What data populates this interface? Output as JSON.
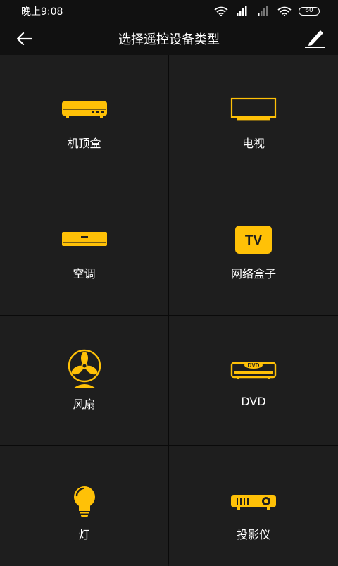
{
  "status": {
    "time": "晚上9:08",
    "battery": "60"
  },
  "header": {
    "title": "选择遥控设备类型"
  },
  "colors": {
    "accent": "#FFC107",
    "background": "#111111",
    "cell": "#1E1E1E"
  },
  "devices": [
    {
      "label": "机顶盒",
      "icon": "set-top-box-icon"
    },
    {
      "label": "电视",
      "icon": "tv-icon"
    },
    {
      "label": "空调",
      "icon": "air-conditioner-icon"
    },
    {
      "label": "网络盒子",
      "icon": "tv-box-icon",
      "badge": "TV"
    },
    {
      "label": "风扇",
      "icon": "fan-icon"
    },
    {
      "label": "DVD",
      "icon": "dvd-icon",
      "badge": "DVD"
    },
    {
      "label": "灯",
      "icon": "light-bulb-icon"
    },
    {
      "label": "投影仪",
      "icon": "projector-icon"
    }
  ]
}
